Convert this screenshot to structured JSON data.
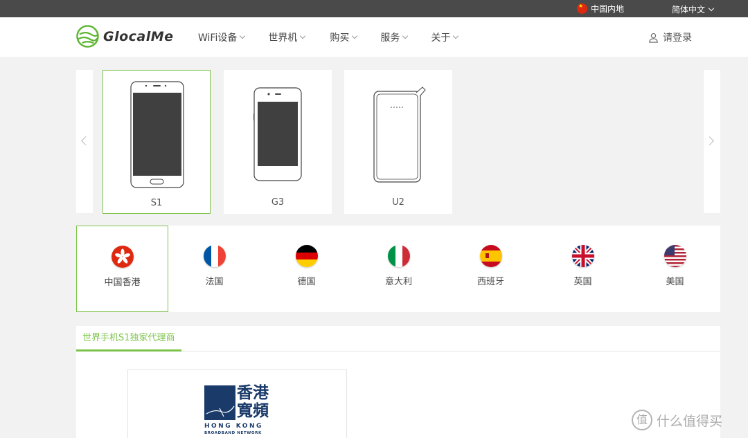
{
  "topbar": {
    "region_label": "中国内地",
    "language_label": "简体中文"
  },
  "header": {
    "logo_text": "GlocalMe",
    "nav": [
      {
        "label": "WiFi设备"
      },
      {
        "label": "世界机"
      },
      {
        "label": "购买"
      },
      {
        "label": "服务"
      },
      {
        "label": "关于"
      }
    ],
    "login_label": "请登录"
  },
  "products": [
    {
      "name": "S1",
      "selected": true
    },
    {
      "name": "G3",
      "selected": false
    },
    {
      "name": "U2",
      "selected": false
    }
  ],
  "countries": [
    {
      "label": "中国香港",
      "flag": "hong-kong",
      "selected": true
    },
    {
      "label": "法国",
      "flag": "france",
      "selected": false
    },
    {
      "label": "德国",
      "flag": "germany",
      "selected": false
    },
    {
      "label": "意大利",
      "flag": "italy",
      "selected": false
    },
    {
      "label": "西班牙",
      "flag": "spain",
      "selected": false
    },
    {
      "label": "英国",
      "flag": "united-kingdom",
      "selected": false
    },
    {
      "label": "美国",
      "flag": "united-states",
      "selected": false
    }
  ],
  "dealer": {
    "tab_label": "世界手机S1独家代理商",
    "logo": {
      "han_line1": "香港",
      "han_line2": "寬頻",
      "en_line1": "HONG KONG",
      "en_line2": "BROADBAND NETWORK"
    }
  },
  "watermark": {
    "icon_glyph": "值",
    "text": "什么值得买"
  },
  "colors": {
    "accent": "#7cc34a",
    "topbar": "#4a4a4a",
    "hkbn_blue": "#1a3a6a"
  }
}
